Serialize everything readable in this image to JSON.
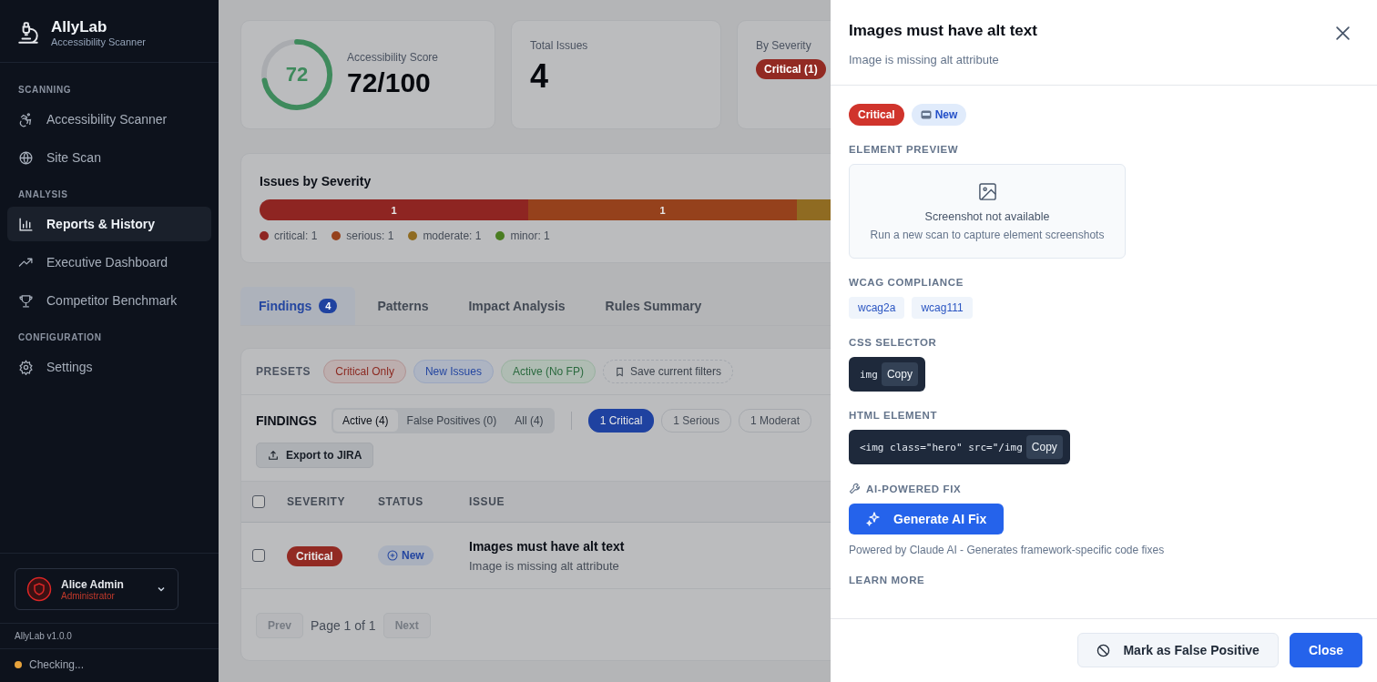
{
  "sidebar": {
    "brand": {
      "name": "AllyLab",
      "tagline": "Accessibility Scanner"
    },
    "sections": [
      {
        "title": "SCANNING",
        "items": [
          {
            "label": "Accessibility Scanner",
            "selected": false
          },
          {
            "label": "Site Scan",
            "selected": false
          }
        ]
      },
      {
        "title": "ANALYSIS",
        "items": [
          {
            "label": "Reports & History",
            "selected": true
          },
          {
            "label": "Executive Dashboard",
            "selected": false
          },
          {
            "label": "Competitor Benchmark",
            "selected": false
          }
        ]
      },
      {
        "title": "CONFIGURATION",
        "items": [
          {
            "label": "Settings",
            "selected": false
          }
        ]
      }
    ],
    "user": {
      "name": "Alice Admin",
      "role": "Administrator"
    },
    "version": "AllyLab v1.0.0",
    "status": "Checking..."
  },
  "stats": {
    "score": {
      "label": "Accessibility Score",
      "value": "72",
      "total": "72/100",
      "level": 0.72
    },
    "total": {
      "label": "Total Issues",
      "value": "4"
    },
    "by_severity": {
      "label": "By Severity",
      "badges": [
        "Critical (1)"
      ]
    }
  },
  "severity_chart": {
    "title": "Issues by Severity",
    "segments": [
      {
        "label": "1",
        "color": "#8e2522"
      },
      {
        "label": "1",
        "color": "#95411c"
      },
      {
        "color": "#8f6b22"
      }
    ],
    "legend": [
      {
        "label": "critical: 1",
        "color": "#8e2522"
      },
      {
        "label": "serious: 1",
        "color": "#95411c"
      },
      {
        "label": "moderate: 1",
        "color": "#8f6b22"
      },
      {
        "label": "minor: 1",
        "color": "#4a7d22"
      }
    ]
  },
  "tabs": [
    {
      "label": "Findings",
      "count": "4",
      "selected": true
    },
    {
      "label": "Patterns",
      "selected": false
    },
    {
      "label": "Impact Analysis",
      "selected": false
    },
    {
      "label": "Rules Summary",
      "selected": false
    }
  ],
  "presets": {
    "label": "PRESETS",
    "items": [
      {
        "label": "Critical Only",
        "kind": "critical"
      },
      {
        "label": "New Issues",
        "kind": "new"
      },
      {
        "label": "Active (No FP)",
        "kind": "active"
      },
      {
        "label": "Save current filters",
        "kind": "save"
      }
    ]
  },
  "findings": {
    "title": "FINDINGS",
    "views": [
      {
        "label": "Active (4)",
        "selected": true
      },
      {
        "label": "False Positives (0)",
        "selected": false
      },
      {
        "label": "All (4)",
        "selected": false
      }
    ],
    "filters": [
      {
        "label": "1 Critical",
        "selected": true
      },
      {
        "label": "1 Serious",
        "selected": false
      },
      {
        "label": "1 Moderat",
        "selected": false
      }
    ],
    "export": "Export to JIRA",
    "select_all_checked": false,
    "columns": [
      "SEVERITY",
      "STATUS",
      "ISSUE"
    ],
    "rows": [
      {
        "checked": false,
        "severity": "Critical",
        "status": "New",
        "title": "Images must have alt text",
        "description": "Image is missing alt attribute"
      }
    ],
    "pagination": {
      "prev": "Prev",
      "page": "Page 1 of 1",
      "next": "Next"
    }
  },
  "drawer": {
    "title": "Images must have alt text",
    "subtitle": "Image is missing alt attribute",
    "badges": [
      {
        "label": "Critical",
        "kind": "critical"
      },
      {
        "label": "New",
        "kind": "new"
      }
    ],
    "preview": {
      "label": "ELEMENT PREVIEW",
      "title": "Screenshot not available",
      "hint": "Run a new scan to capture element screenshots"
    },
    "wcag": {
      "label": "WCAG COMPLIANCE",
      "tags": [
        "wcag2a",
        "wcag111"
      ]
    },
    "selector": {
      "label": "CSS SELECTOR",
      "code": "img",
      "copy": "Copy"
    },
    "html": {
      "label": "HTML ELEMENT",
      "code": "<img class=\"hero\" src=\"/img",
      "copy": "Copy"
    },
    "ai": {
      "label": "AI-POWERED FIX",
      "button": "Generate AI Fix",
      "note": "Powered by Claude AI - Generates framework-specific code fixes"
    },
    "learn_more": {
      "label": "LEARN MORE"
    },
    "actions": [
      {
        "label": "Mark as False Positive",
        "kind": "secondary"
      },
      {
        "label": "Close",
        "kind": "primary"
      }
    ]
  }
}
